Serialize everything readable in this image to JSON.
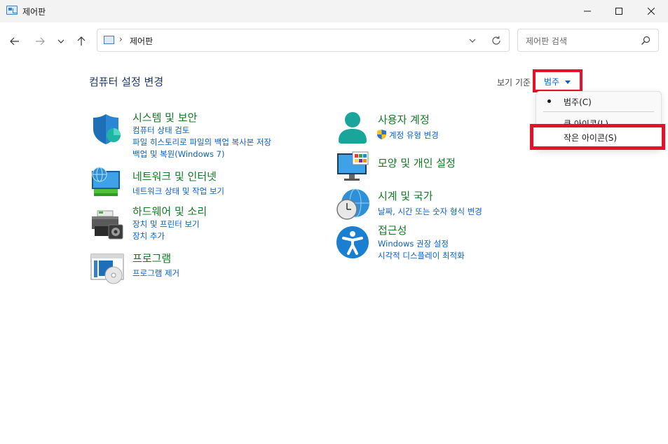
{
  "window": {
    "title": "제어판"
  },
  "address": {
    "path": "제어판"
  },
  "search": {
    "placeholder": "제어판 검색"
  },
  "header": {
    "title": "컴퓨터 설정 변경",
    "view_by_label": "보기 기준",
    "view_by_value": "범주"
  },
  "categories": {
    "system": {
      "title": "시스템 및 보안",
      "links": [
        "컴퓨터 상태 검토",
        "파일 히스토리로 파일의 백업 복사본 저장",
        "백업 및 복원(Windows 7)"
      ]
    },
    "network": {
      "title": "네트워크 및 인터넷",
      "links": [
        "네트워크 상태 및 작업 보기"
      ]
    },
    "hardware": {
      "title": "하드웨어 및 소리",
      "links": [
        "장치 및 프린터 보기",
        "장치 추가"
      ]
    },
    "programs": {
      "title": "프로그램",
      "links": [
        "프로그램 제거"
      ]
    },
    "users": {
      "title": "사용자 계정",
      "links": [
        "계정 유형 변경"
      ]
    },
    "appearance": {
      "title": "모양 및 개인 설정",
      "links": []
    },
    "clock": {
      "title": "시계 및 국가",
      "links": [
        "날짜, 시간 또는 숫자 형식 변경"
      ]
    },
    "ease": {
      "title": "접근성",
      "links": [
        "Windows 권장 설정",
        "시각적 디스플레이 최적화"
      ]
    }
  },
  "view_menu": {
    "items": [
      "범주(C)",
      "큰 아이콘(L)",
      "작은 아이콘(S)"
    ],
    "selected": "범주(C)"
  },
  "colors": {
    "link": "#0b61c4",
    "category_title": "#117a24",
    "highlight": "#e8112b"
  }
}
